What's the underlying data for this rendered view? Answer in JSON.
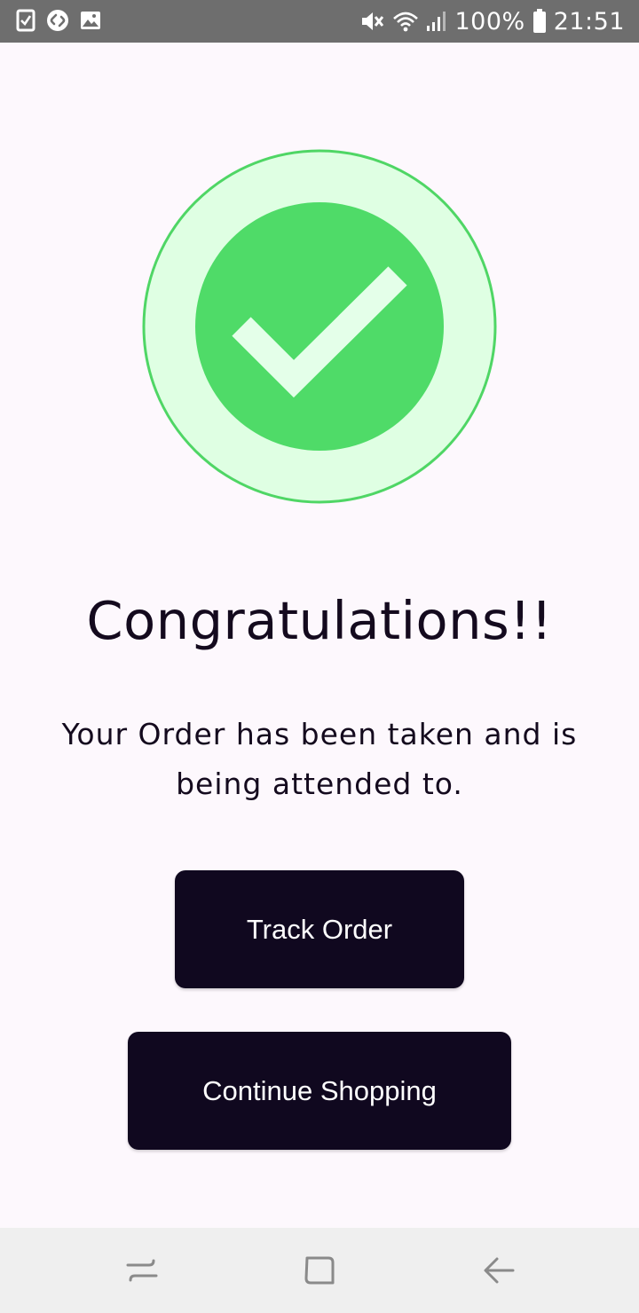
{
  "status_bar": {
    "battery": "100%",
    "time": "21:51",
    "icons": [
      "checklist-icon",
      "shazam-icon",
      "image-icon",
      "mute-icon",
      "wifi-icon",
      "signal-icon",
      "battery-icon"
    ]
  },
  "success": {
    "icon": "check-icon",
    "colors": {
      "outer_fill": "#dfffe3",
      "outer_stroke": "#4fd665",
      "inner_fill": "#4fdb68",
      "check": "#e4ffe9"
    }
  },
  "content": {
    "title": "Congratulations!!",
    "message": "Your Order has been taken and is being attended to."
  },
  "buttons": {
    "track_order": "Track Order",
    "continue_shopping": "Continue Shopping"
  },
  "nav_bar": {
    "icons": [
      "recents-icon",
      "home-icon",
      "back-icon"
    ]
  }
}
